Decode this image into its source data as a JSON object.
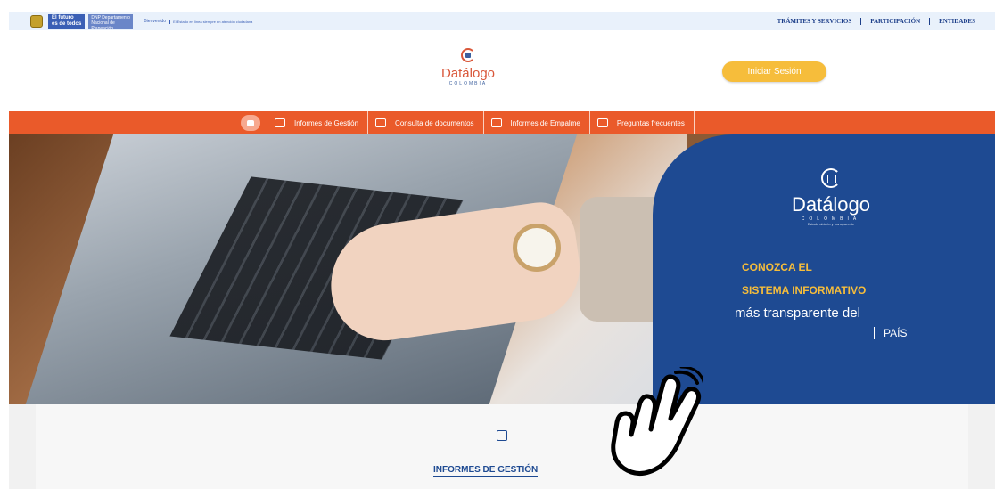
{
  "topbar": {
    "gov_line1": "El futuro",
    "gov_line2": "es de todos",
    "dept_label": "DNP Departamento Nacional de Planeación",
    "section_label": "Bienvenido",
    "tiny_text": "El Estado en línea siempre en atención ciudadana",
    "links": [
      "TRÁMITES Y SERVICIOS",
      "PARTICIPACIÓN",
      "ENTIDADES"
    ]
  },
  "header": {
    "logo_title": "Datálogo",
    "logo_country": "COLOMBIA",
    "login_label": "Iniciar Sesión"
  },
  "nav": {
    "items": [
      {
        "label": "Informes de Gestión",
        "icon": "presentation-icon"
      },
      {
        "label": "Consulta de documentos",
        "icon": "document-search-icon"
      },
      {
        "label": "Informes de Empalme",
        "icon": "handshake-icon"
      },
      {
        "label": "Preguntas frecuentes",
        "icon": "eye-icon"
      }
    ]
  },
  "hero": {
    "brand": "Datálogo",
    "country": "COLOMBIA",
    "tagline_small": "Estado abierto y transparente",
    "line1": "CONOZCA EL",
    "line2": "SISTEMA INFORMATIVO",
    "line3": "más transparente del",
    "line4": "PAÍS"
  },
  "section": {
    "title": "INFORMES DE GESTIÓN",
    "icon": "presentation-icon"
  },
  "colors": {
    "accent_orange": "#ea5a2a",
    "panel_blue": "#1e4a92",
    "button_yellow": "#f6bd3b"
  }
}
